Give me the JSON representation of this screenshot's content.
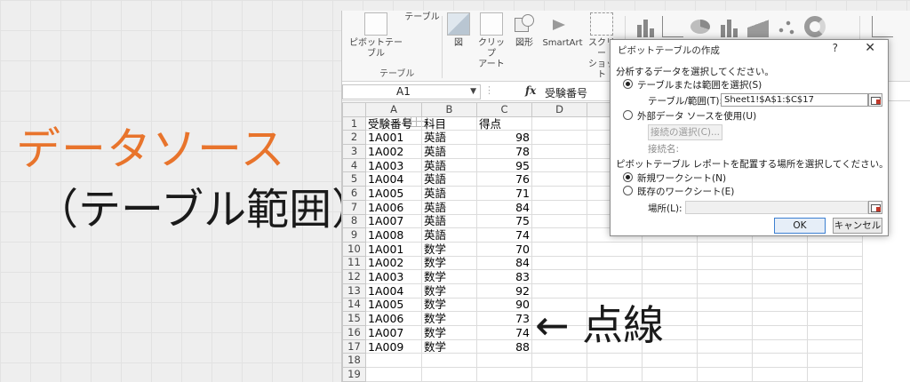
{
  "annotations": {
    "title": "データソース",
    "subtitle": "（テーブル範囲）",
    "dotted_line": "← 点線"
  },
  "ribbon": {
    "buttons": [
      {
        "label1": "ピボットテーブル",
        "label2": ""
      },
      {
        "label1": "テーブル",
        "label2": ""
      },
      {
        "label1": "図",
        "label2": ""
      },
      {
        "label1": "クリップ",
        "label2": "アート"
      },
      {
        "label1": "図形",
        "label2": "▾"
      },
      {
        "label1": "SmartArt",
        "label2": ""
      },
      {
        "label1": "スクリー",
        "label2": "ショット"
      }
    ],
    "group_table": "テーブル"
  },
  "formula_bar": {
    "name_box": "A1",
    "fx": "fx",
    "content": "受験番号"
  },
  "sheet": {
    "columns": [
      "A",
      "B",
      "C",
      "D"
    ],
    "rows": [
      {
        "n": "1",
        "a": "受験番号",
        "b": "科目",
        "c": "得点"
      },
      {
        "n": "2",
        "a": "1A001",
        "b": "英語",
        "c": "98"
      },
      {
        "n": "3",
        "a": "1A002",
        "b": "英語",
        "c": "78"
      },
      {
        "n": "4",
        "a": "1A003",
        "b": "英語",
        "c": "95"
      },
      {
        "n": "5",
        "a": "1A004",
        "b": "英語",
        "c": "76"
      },
      {
        "n": "6",
        "a": "1A005",
        "b": "英語",
        "c": "71"
      },
      {
        "n": "7",
        "a": "1A006",
        "b": "英語",
        "c": "84"
      },
      {
        "n": "8",
        "a": "1A007",
        "b": "英語",
        "c": "75"
      },
      {
        "n": "9",
        "a": "1A008",
        "b": "英語",
        "c": "74"
      },
      {
        "n": "10",
        "a": "1A001",
        "b": "数学",
        "c": "70"
      },
      {
        "n": "11",
        "a": "1A002",
        "b": "数学",
        "c": "84"
      },
      {
        "n": "12",
        "a": "1A003",
        "b": "数学",
        "c": "83"
      },
      {
        "n": "13",
        "a": "1A004",
        "b": "数学",
        "c": "92"
      },
      {
        "n": "14",
        "a": "1A005",
        "b": "数学",
        "c": "90"
      },
      {
        "n": "15",
        "a": "1A006",
        "b": "数学",
        "c": "73"
      },
      {
        "n": "16",
        "a": "1A007",
        "b": "数学",
        "c": "74"
      },
      {
        "n": "17",
        "a": "1A009",
        "b": "数学",
        "c": "88"
      },
      {
        "n": "18",
        "a": "",
        "b": "",
        "c": ""
      },
      {
        "n": "19",
        "a": "",
        "b": "",
        "c": ""
      }
    ]
  },
  "dialog": {
    "title": "ピボットテーブルの作成",
    "help": "?",
    "close": "✕",
    "section1": "分析するデータを選択してください。",
    "opt_table": "テーブルまたは範囲を選択(S)",
    "range_label": "テーブル/範囲(T):",
    "range_value": "Sheet1!$A$1:$C$17",
    "opt_external": "外部データ ソースを使用(U)",
    "choose_conn": "接続の選択(C)...",
    "conn_name": "接続名:",
    "section2": "ピボットテーブル レポートを配置する場所を選択してください。",
    "opt_new": "新規ワークシート(N)",
    "opt_existing": "既存のワークシート(E)",
    "location_label": "場所(L):",
    "location_value": "",
    "ok": "OK",
    "cancel": "キャンセル"
  }
}
